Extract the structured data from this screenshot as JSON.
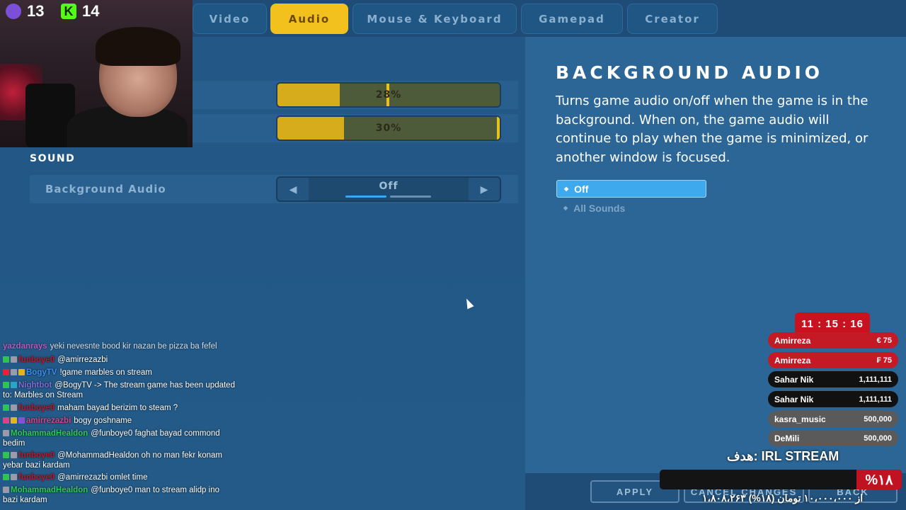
{
  "tabs": [
    {
      "label": "Video",
      "active": false
    },
    {
      "label": "Audio",
      "active": true
    },
    {
      "label": "Mouse & Keyboard",
      "active": false
    },
    {
      "label": "Gamepad",
      "active": false
    },
    {
      "label": "Creator",
      "active": false
    }
  ],
  "sliders": [
    {
      "value_label": "28%",
      "value": 0.28
    },
    {
      "value_label": "30%",
      "value": 0.3
    }
  ],
  "section": {
    "title": "SOUND"
  },
  "background_audio": {
    "label": "Background Audio",
    "value": "Off",
    "prev_icon": "triangle-left-icon",
    "next_icon": "triangle-right-icon"
  },
  "description": {
    "title": "BACKGROUND AUDIO",
    "body": "Turns game audio on/off when the game is in the background. When on, the game audio will continue to play when the game is minimized, or another window is focused.",
    "options": [
      {
        "label": "Off",
        "selected": true
      },
      {
        "label": "All Sounds",
        "selected": false
      }
    ]
  },
  "webcam": {
    "counter1": "13",
    "counter2": "14",
    "counter2_glyph": "K"
  },
  "chat": [
    {
      "user": "yazdanrays",
      "color": "#d25fd0",
      "text": "yeki nevesnte bood kir nazan be pizza ba fefel"
    },
    {
      "user": "funboye0",
      "color": "#c0182a",
      "text": "@amirrezazbi"
    },
    {
      "user": "BogyTV",
      "color": "#3b8ff2",
      "text": "!game marbles on stream"
    },
    {
      "user": "Nightbot",
      "color": "#7d6fd8",
      "text": "@BogyTV -> The stream game has been updated to: Marbles on Stream"
    },
    {
      "user": "funboye0",
      "color": "#c0182a",
      "text": "maham bayad berizim to steam ?"
    },
    {
      "user": "amirrezazbi",
      "color": "#e04088",
      "text": "bogy goshname"
    },
    {
      "user": "MohammadHealdon",
      "color": "#2ecb5a",
      "text": "@funboye0 faghat bayad commond bedim"
    },
    {
      "user": "funboye0",
      "color": "#c0182a",
      "text": "@MohammadHealdon oh no man fekr konam yebar bazi kardam"
    },
    {
      "user": "funboye0",
      "color": "#c0182a",
      "text": "@amirrezazbi omlet time"
    },
    {
      "user": "MohammadHealdon",
      "color": "#2ecb5a",
      "text": "@funboye0 man to stream alidp ino bazi kardam"
    }
  ],
  "donations": {
    "timer": "11 : 15 : 16",
    "items": [
      {
        "name": "Amirreza",
        "amount": "€ 75",
        "style": "red"
      },
      {
        "name": "Amirreza",
        "amount": "₣ 75",
        "style": "red"
      },
      {
        "name": "Sahar Nik",
        "amount": "1,111,111",
        "style": "black"
      },
      {
        "name": "Sahar Nik",
        "amount": "1,111,111",
        "style": "black"
      },
      {
        "name": "kasra_music",
        "amount": "500,000",
        "style": "grey"
      },
      {
        "name": "DeMili",
        "amount": "500,000",
        "style": "grey"
      }
    ],
    "goal_label": "هدف: IRL STREAM",
    "goal_percent": "%۱۸",
    "goal_progress": 0.18,
    "goal_text": "۱،۸۰۸،۲۶۳ از ۱۰،۰۰۰،۰۰۰ تومان (۱۸%)"
  },
  "bottom": {
    "apply": "APPLY",
    "cancel": "CANCEL CHANGES",
    "back": "BACK"
  }
}
